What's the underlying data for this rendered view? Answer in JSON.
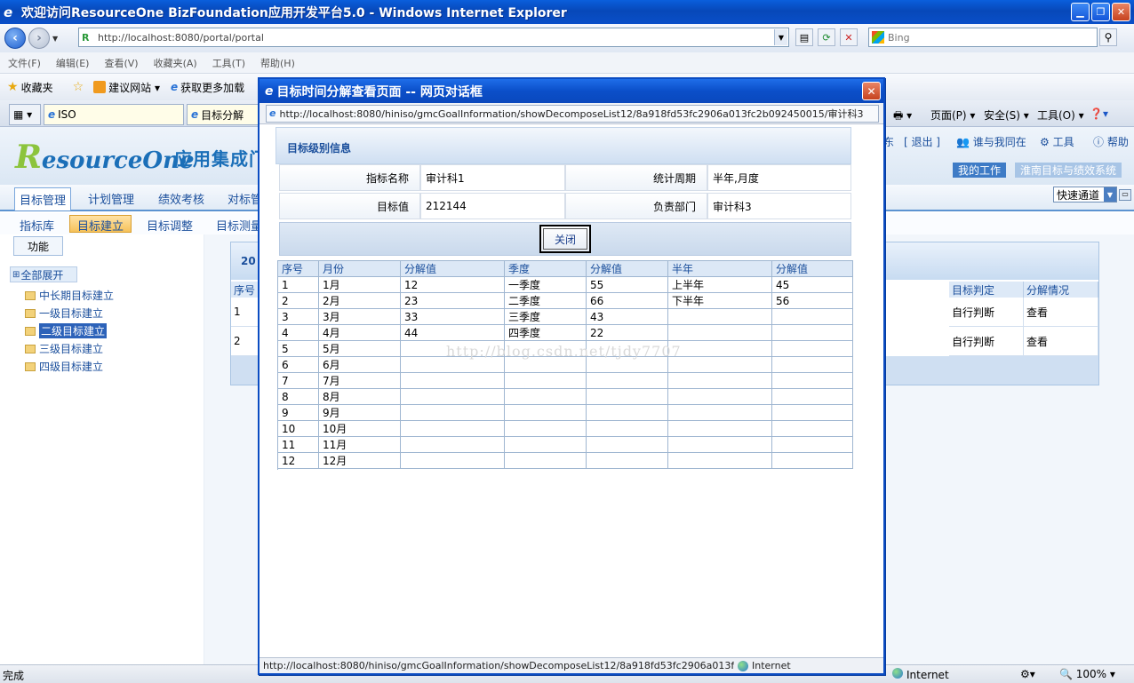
{
  "window": {
    "title": "欢迎访问ResourceOne BizFoundation应用开发平台5.0 - Windows Internet Explorer",
    "minimize": "▁",
    "restore": "❐",
    "close": "✕"
  },
  "address": {
    "url": "http://localhost:8080/portal/portal",
    "search_placeholder": "Bing"
  },
  "menubar": [
    "文件(F)",
    "编辑(E)",
    "查看(V)",
    "收藏夹(A)",
    "工具(T)",
    "帮助(H)"
  ],
  "favorites": {
    "label": "收藏夹",
    "items": [
      "建议网站 ▾",
      "获取更多加载"
    ]
  },
  "tabs": [
    "ISO",
    "目标分解"
  ],
  "command_right": [
    "页面(P) ▾",
    "安全(S) ▾",
    "工具(O) ▾"
  ],
  "portal": {
    "logo_text": "esourceOne",
    "logo_r": "R",
    "logo_cn": "应用集成门",
    "header_links": [
      "东",
      "[ 退出 ]",
      "谁与我同在",
      "工具",
      "帮助"
    ],
    "pills": [
      "我的工作",
      "淮南目标与绩效系统"
    ],
    "quick_channel": "快速通道",
    "main_nav": [
      "目标管理",
      "计划管理",
      "绩效考核",
      "对标管"
    ],
    "sub_nav": [
      "指标库",
      "目标建立",
      "目标调整",
      "目标测量"
    ],
    "side_tab": "功能",
    "expand_all": "全部展开",
    "tree": [
      "中长期目标建立",
      "一级目标建立",
      "二级目标建立",
      "三级目标建立",
      "四级目标建立"
    ],
    "panel_year": "20",
    "table_headers": [
      "序号",
      "目标判定",
      "分解情况"
    ],
    "rows": [
      {
        "no": "1",
        "judge": "自行判断",
        "action": "查看"
      },
      {
        "no": "2",
        "judge": "自行判断",
        "action": "查看"
      }
    ]
  },
  "status": {
    "left": "完成",
    "zone": "Internet",
    "zoom": "100%"
  },
  "dialog": {
    "title": "目标时间分解查看页面 -- 网页对话框",
    "url": "http://localhost:8080/hiniso/gmcGoalInformation/showDecomposeList12/8a918fd53fc2906a013fc2b092450015/审计科3",
    "info_title": "目标级别信息",
    "labels": {
      "indicator_name": "指标名称",
      "period": "统计周期",
      "target_value": "目标值",
      "department": "负责部门"
    },
    "values": {
      "indicator_name": "审计科1",
      "period": "半年,月度",
      "target_value": "212144",
      "department": "审计科3"
    },
    "close_button": "关闭",
    "grid_headers": [
      "序号",
      "月份",
      "分解值",
      "季度",
      "分解值",
      "半年",
      "分解值"
    ],
    "grid_rows": [
      [
        "1",
        "1月",
        "12",
        "一季度",
        "55",
        "上半年",
        "45"
      ],
      [
        "2",
        "2月",
        "23",
        "二季度",
        "66",
        "下半年",
        "56"
      ],
      [
        "3",
        "3月",
        "33",
        "三季度",
        "43",
        "",
        ""
      ],
      [
        "4",
        "4月",
        "44",
        "四季度",
        "22",
        "",
        ""
      ],
      [
        "5",
        "5月",
        "",
        "",
        "",
        "",
        ""
      ],
      [
        "6",
        "6月",
        "",
        "",
        "",
        "",
        ""
      ],
      [
        "7",
        "7月",
        "",
        "",
        "",
        "",
        ""
      ],
      [
        "8",
        "8月",
        "",
        "",
        "",
        "",
        ""
      ],
      [
        "9",
        "9月",
        "",
        "",
        "",
        "",
        ""
      ],
      [
        "10",
        "10月",
        "",
        "",
        "",
        "",
        ""
      ],
      [
        "11",
        "11月",
        "",
        "",
        "",
        "",
        ""
      ],
      [
        "12",
        "12月",
        "",
        "",
        "",
        "",
        ""
      ]
    ],
    "watermark": "http://blog.csdn.net/tjdy7707",
    "status_url": "http://localhost:8080/hiniso/gmcGoalInformation/showDecomposeList12/8a918fd53fc2906a013fc2b09245001!",
    "status_zone": "Internet"
  }
}
